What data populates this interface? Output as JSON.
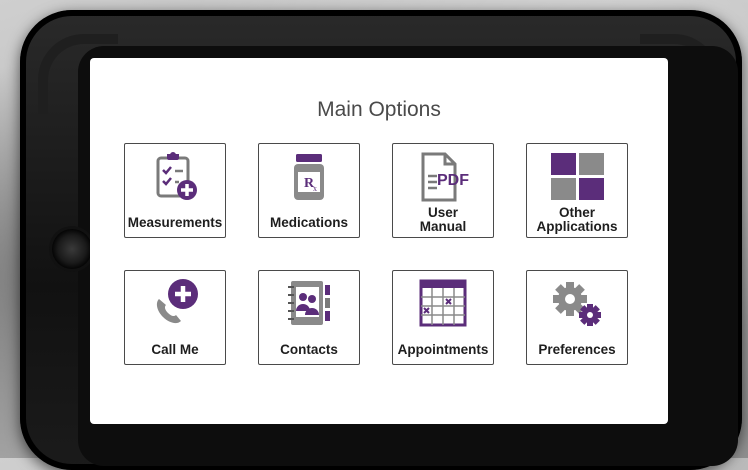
{
  "screen": {
    "title": "Main Options",
    "tiles": [
      {
        "label": "Measurements",
        "icon": "clipboard-checklist-plus-icon"
      },
      {
        "label": "Medications",
        "icon": "rx-bottle-icon"
      },
      {
        "label_line1": "User",
        "label_line2": "Manual",
        "icon": "pdf-document-icon"
      },
      {
        "label_line1": "Other",
        "label_line2": "Applications",
        "icon": "app-grid-icon"
      },
      {
        "label": "Call Me",
        "icon": "phone-plus-icon"
      },
      {
        "label": "Contacts",
        "icon": "contacts-book-icon"
      },
      {
        "label": "Appointments",
        "icon": "calendar-icon"
      },
      {
        "label": "Preferences",
        "icon": "gears-icon"
      }
    ]
  },
  "colors": {
    "accent_purple": "#5b2d7a",
    "icon_gray": "#7a7a7a",
    "border": "#4a4a4a"
  }
}
